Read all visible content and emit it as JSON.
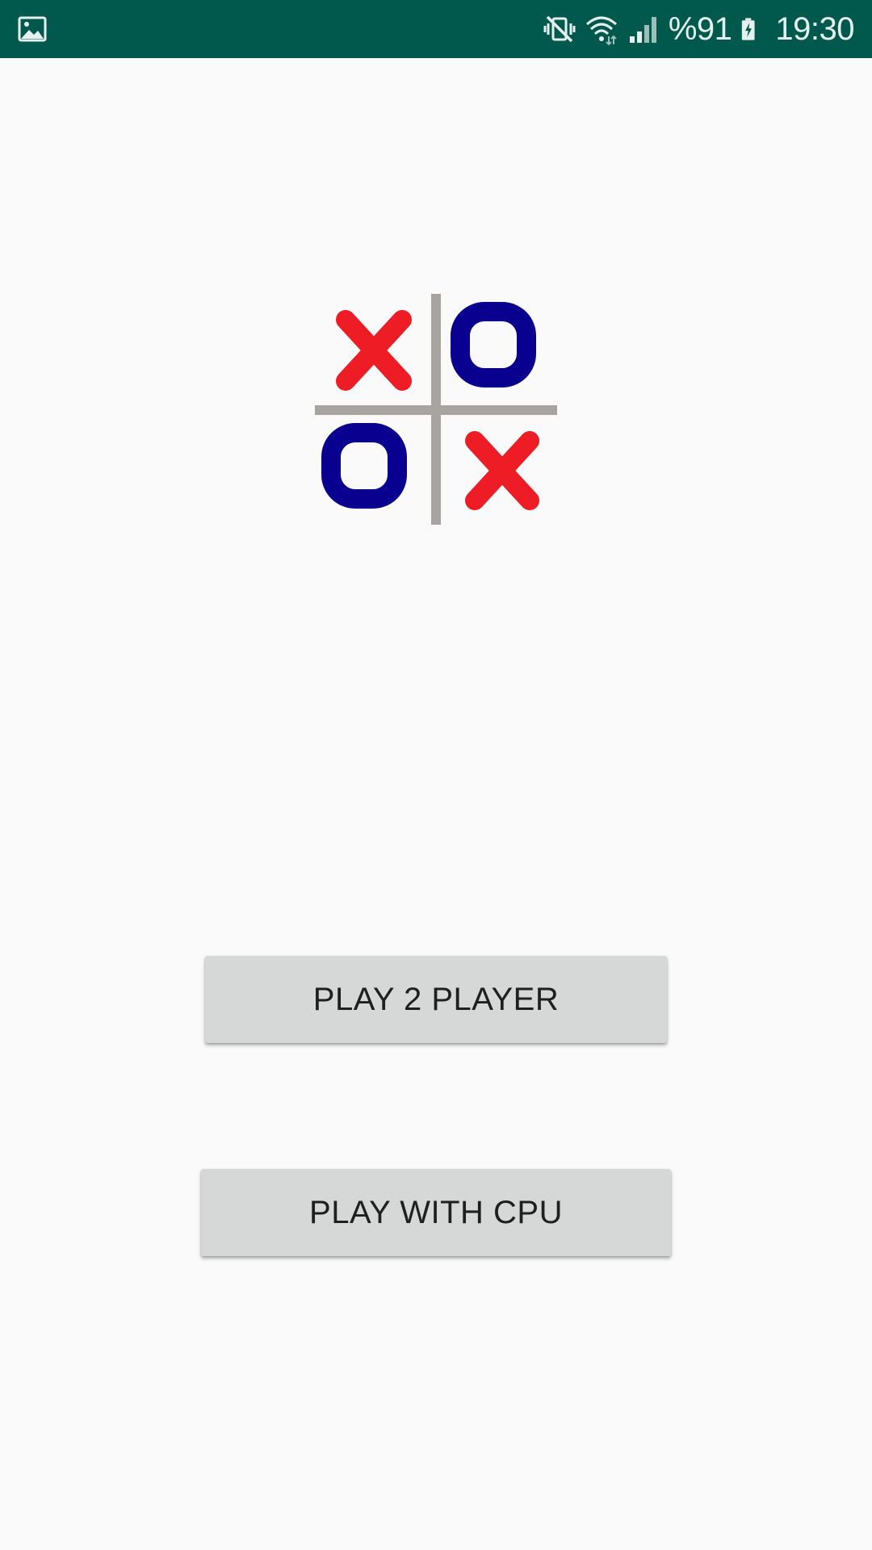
{
  "status_bar": {
    "notification_icon": "image-icon",
    "icons": [
      "vibrate-mute-icon",
      "wifi-icon",
      "signal-icon",
      "battery-charging-icon"
    ],
    "battery_text": "%91",
    "time": "19:30",
    "background_color": "#00594c"
  },
  "logo": {
    "cells": [
      "X",
      "O",
      "O",
      "X"
    ],
    "x_color": "#ee1c25",
    "o_color": "#0a0090",
    "grid_color": "#a8a5a0"
  },
  "buttons": {
    "play_2_player": "PLAY 2 PLAYER",
    "play_with_cpu": "PLAY WITH CPU"
  }
}
